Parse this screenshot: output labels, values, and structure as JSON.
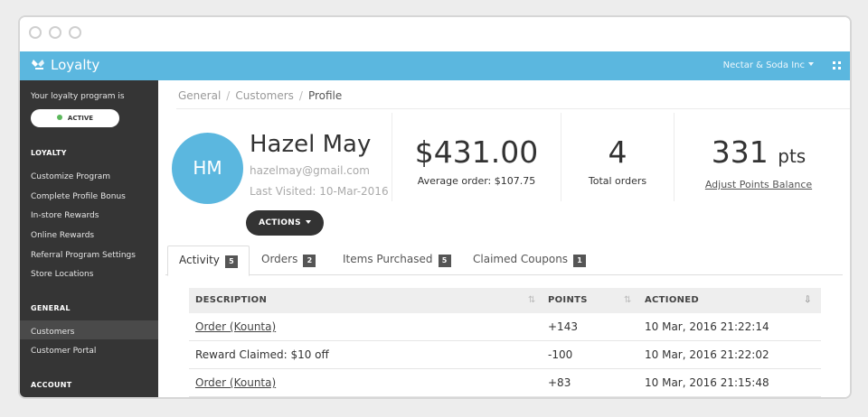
{
  "app": {
    "name": "Loyalty",
    "company": "Nectar & Soda Inc"
  },
  "sidebar": {
    "intro": "Your loyalty program is",
    "status": "ACTIVE",
    "sections": [
      {
        "heading": "LOYALTY",
        "items": [
          "Customize Program",
          "Complete Profile Bonus",
          "In-store Rewards",
          "Online Rewards",
          "Referral Program Settings",
          "Store Locations"
        ]
      },
      {
        "heading": "GENERAL",
        "items": [
          "Customers",
          "Customer Portal"
        ]
      },
      {
        "heading": "ACCOUNT",
        "items": []
      }
    ]
  },
  "breadcrumb": [
    "General",
    "Customers",
    "Profile"
  ],
  "profile": {
    "initials": "HM",
    "name": "Hazel May",
    "email": "hazelmay@gmail.com",
    "last_visited": "Last Visited: 10-Mar-2016",
    "actions_label": "ACTIONS"
  },
  "stats": {
    "total_spent": "$431.00",
    "average_order": "Average order: $107.75",
    "orders_count": "4",
    "orders_label": "Total orders",
    "points_value": "331",
    "points_unit": "pts",
    "points_link": "Adjust Points Balance"
  },
  "tabs": [
    {
      "label": "Activity",
      "count": "5"
    },
    {
      "label": "Orders",
      "count": "2"
    },
    {
      "label": "Items Purchased",
      "count": "5"
    },
    {
      "label": "Claimed Coupons",
      "count": "1"
    }
  ],
  "table": {
    "headers": [
      "DESCRIPTION",
      "POINTS",
      "ACTIONED"
    ],
    "rows": [
      {
        "description": "Order (Kounta)",
        "points": "+143",
        "actioned": "10 Mar, 2016 21:22:14"
      },
      {
        "description": "Reward Claimed: $10 off",
        "points": "-100",
        "actioned": "10 Mar, 2016 21:22:02"
      },
      {
        "description": "Order (Kounta)",
        "points": "+83",
        "actioned": "10 Mar, 2016 21:15:48"
      }
    ]
  },
  "colors": {
    "accent": "#5bb7df",
    "sidebar": "#353535",
    "active_status": "#5cb85c"
  }
}
